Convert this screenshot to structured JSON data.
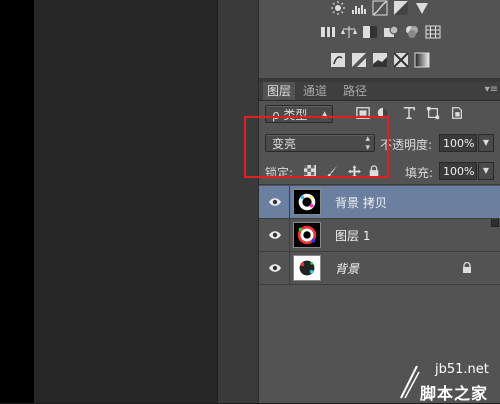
{
  "tabs": [
    {
      "label": "图层"
    },
    {
      "label": "通道"
    },
    {
      "label": "路径"
    }
  ],
  "filter": {
    "kind_label": "ρ 类型",
    "icons": [
      "pixel-filter-icon",
      "adjustment-filter-icon",
      "type-filter-icon",
      "shape-filter-icon",
      "smart-object-filter-icon"
    ]
  },
  "blend": {
    "mode": "变亮",
    "opacity_label": "不透明度:",
    "opacity_value": "100%"
  },
  "lock": {
    "label": "锁定:",
    "fill_label": "填充:",
    "fill_value": "100%"
  },
  "layers": [
    {
      "name": "背景 拷贝",
      "selected": true
    },
    {
      "name": "图层 1",
      "selected": false
    },
    {
      "name": "背景",
      "selected": false
    }
  ],
  "watermark": {
    "site": "jb51.net",
    "brand": "脚本之家"
  }
}
